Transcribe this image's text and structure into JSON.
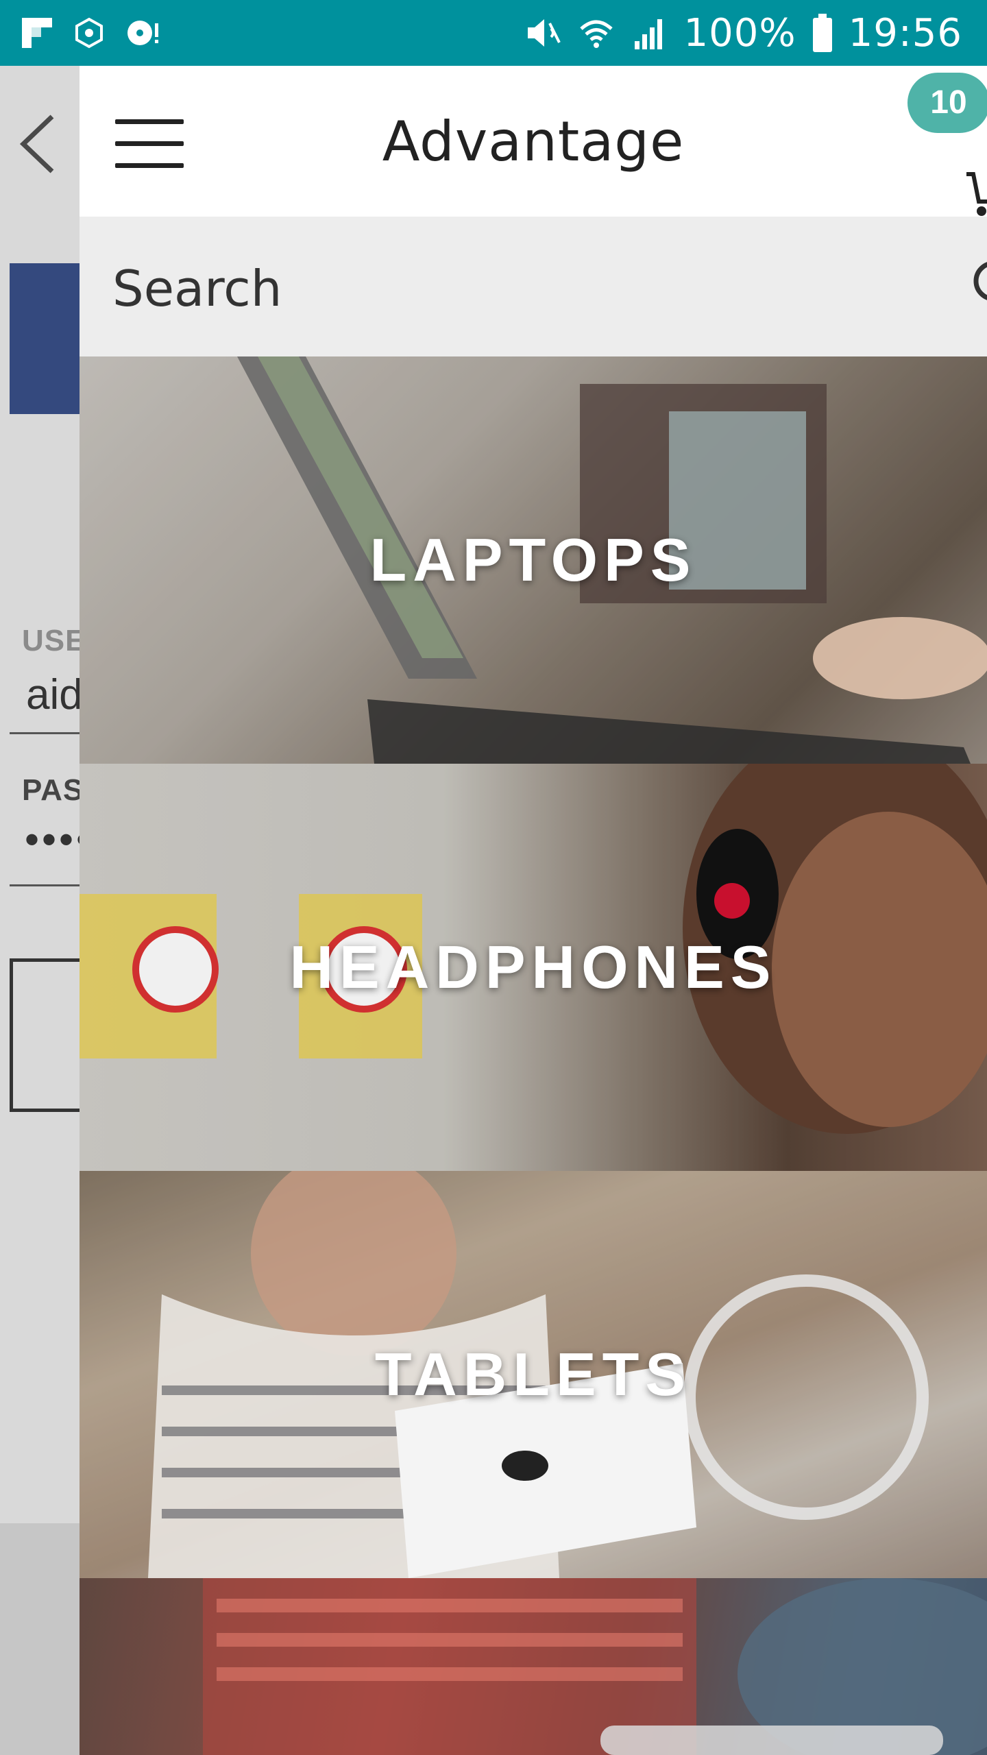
{
  "status_bar": {
    "battery": "100%",
    "time": "19:56",
    "icons": [
      "flipboard-icon",
      "app-icon",
      "disc-icon",
      "mute-icon",
      "wifi-icon",
      "signal-icon",
      "battery-icon"
    ]
  },
  "background_login": {
    "username_label": "USE",
    "username_value": "aid",
    "password_label": "PAS",
    "password_value": "••••"
  },
  "header": {
    "title": "Advantage",
    "cart_count": "10"
  },
  "search": {
    "placeholder": "Search"
  },
  "categories": [
    {
      "label": "LAPTOPS"
    },
    {
      "label": "HEADPHONES"
    },
    {
      "label": "TABLETS"
    }
  ],
  "colors": {
    "status_bar": "#00919d",
    "badge": "#4fb3a8",
    "search_bg": "#ededed",
    "login_button_blue": "#34497e"
  }
}
